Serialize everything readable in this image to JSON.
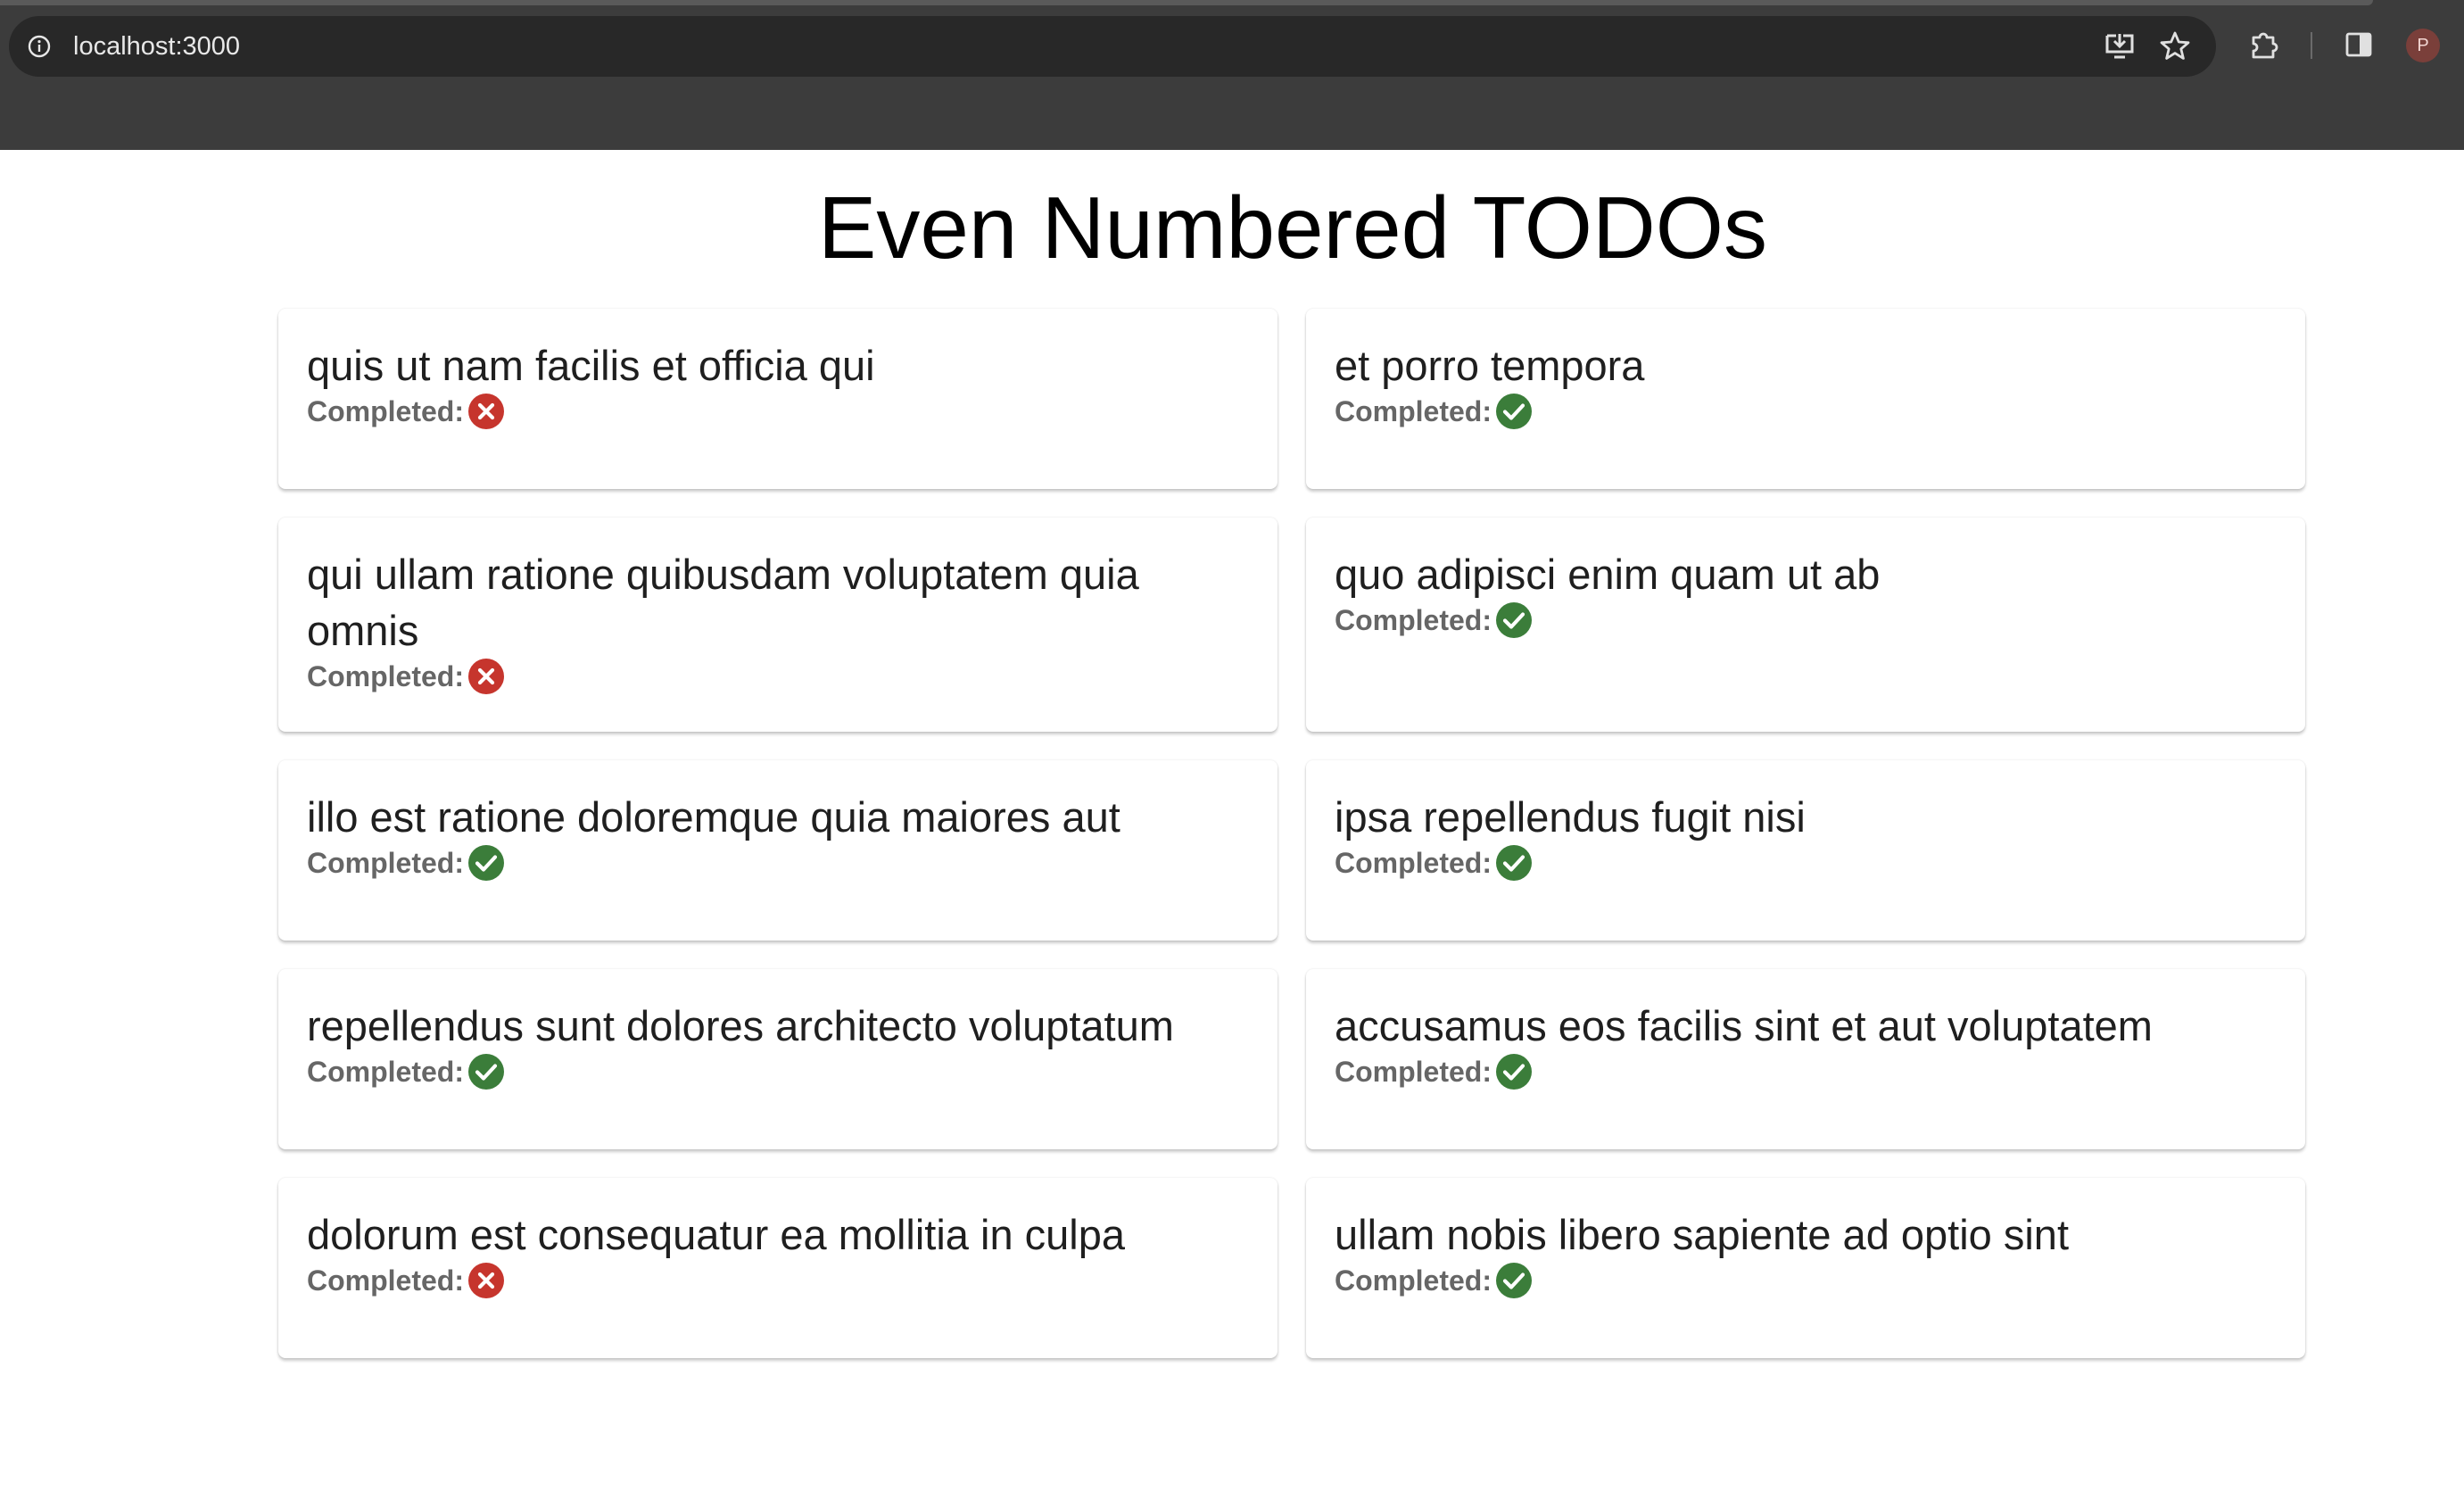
{
  "browser": {
    "url": "localhost:3000",
    "avatar_letter": "P",
    "icons": [
      "info-icon",
      "install-app-icon",
      "star-icon",
      "extensions-icon",
      "side-panel-icon"
    ]
  },
  "page": {
    "title": "Even Numbered TODOs",
    "status_label": "Completed:"
  },
  "colors": {
    "done": "#3b7d3a",
    "not_done": "#c6352d"
  },
  "todos": [
    {
      "title": "quis ut nam facilis et officia qui",
      "completed": false
    },
    {
      "title": "et porro tempora",
      "completed": true
    },
    {
      "title": "qui ullam ratione quibusdam voluptatem quia omnis",
      "completed": false
    },
    {
      "title": "quo adipisci enim quam ut ab",
      "completed": true
    },
    {
      "title": "illo est ratione doloremque quia maiores aut",
      "completed": true
    },
    {
      "title": "ipsa repellendus fugit nisi",
      "completed": true
    },
    {
      "title": "repellendus sunt dolores architecto voluptatum",
      "completed": true
    },
    {
      "title": "accusamus eos facilis sint et aut voluptatem",
      "completed": true
    },
    {
      "title": "dolorum est consequatur ea mollitia in culpa",
      "completed": false
    },
    {
      "title": "ullam nobis libero sapiente ad optio sint",
      "completed": true
    }
  ]
}
